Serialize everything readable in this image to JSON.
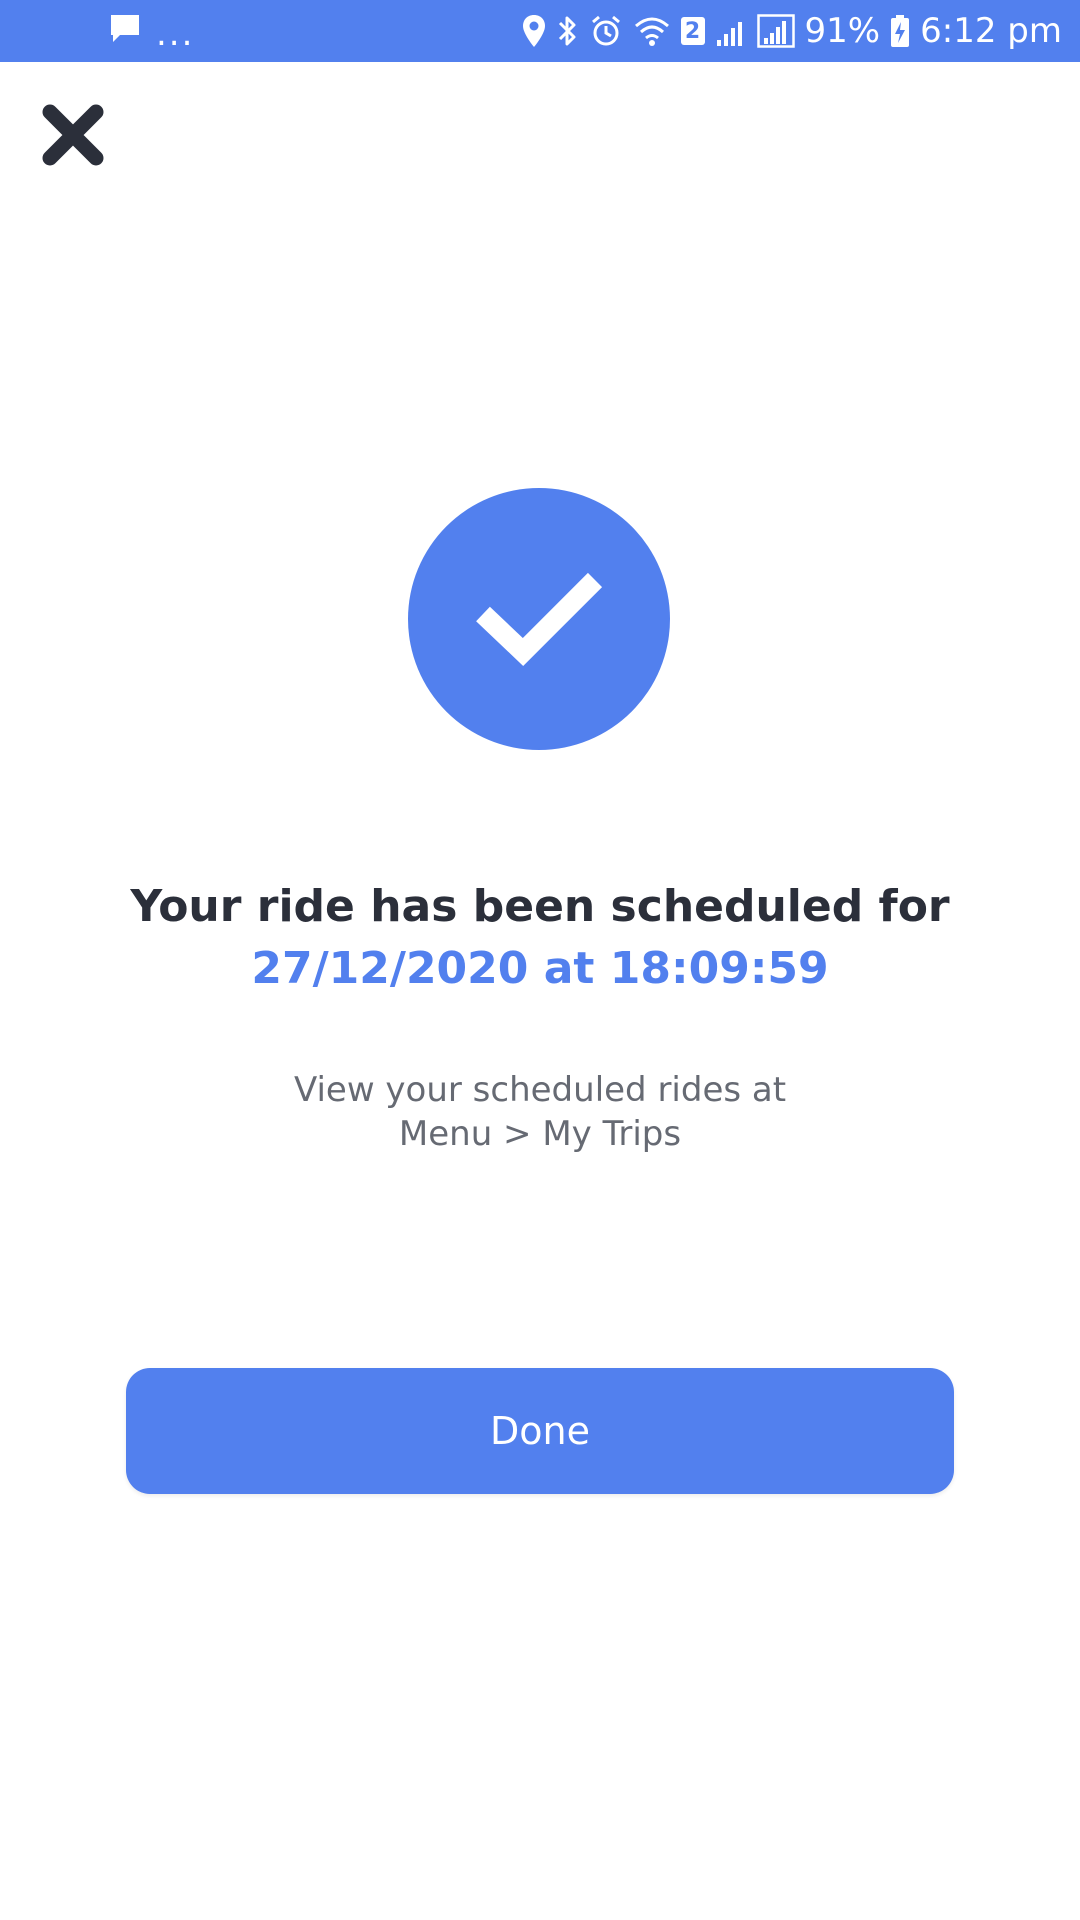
{
  "status_bar": {
    "notification_icon": "chat-bubble-icon",
    "overflow": "...",
    "sim_badge": "2",
    "battery": "91%",
    "time": "6:12 pm",
    "icons": [
      "location-icon",
      "bluetooth-icon",
      "alarm-icon",
      "wifi-icon",
      "signal-icon",
      "signal-icon",
      "battery-charging-icon"
    ]
  },
  "close": {
    "icon": "close-icon"
  },
  "success": {
    "icon": "checkmark-icon"
  },
  "headline": "Your ride has been scheduled for",
  "schedule": {
    "datetime": "27/12/2020 at 18:09:59"
  },
  "info": {
    "line1": "View your scheduled rides at",
    "line2": "Menu > My Trips"
  },
  "done_label": "Done",
  "colors": {
    "accent": "#5280ee",
    "text_dark": "#2b2f3a",
    "text_muted": "#666a73",
    "background": "#ffffff"
  }
}
